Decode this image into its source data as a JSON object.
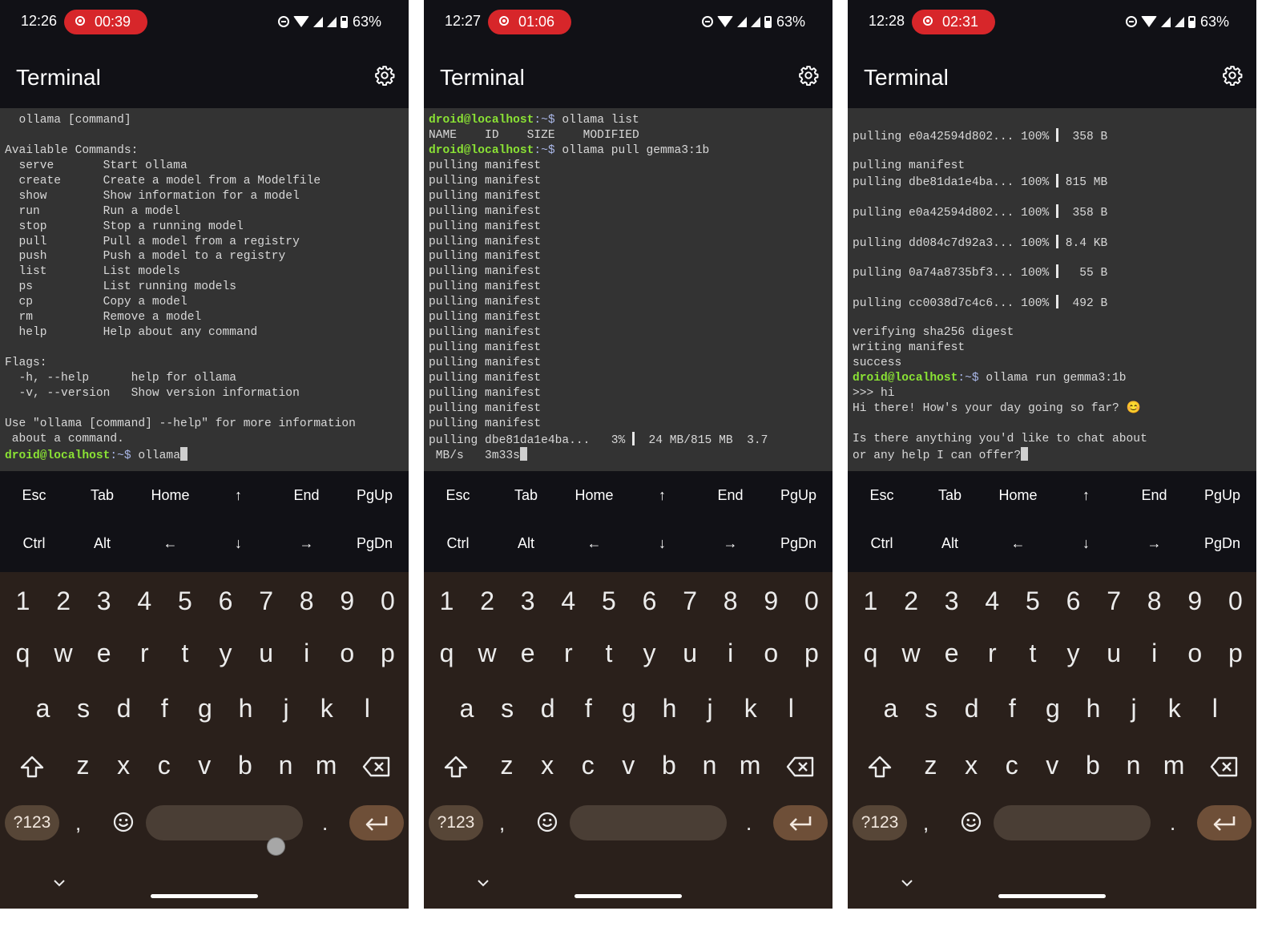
{
  "screens": [
    {
      "clock": "12:26",
      "rec_time": "00:39",
      "battery": "63%",
      "title": "Terminal",
      "show_touch": true,
      "terminal_lines": [
        [
          {
            "t": "  ollama [command]"
          }
        ],
        [
          {
            "t": ""
          }
        ],
        [
          {
            "t": "Available Commands:"
          }
        ],
        [
          {
            "t": "  serve       Start ollama"
          }
        ],
        [
          {
            "t": "  create      Create a model from a Modelfile"
          }
        ],
        [
          {
            "t": "  show        Show information for a model"
          }
        ],
        [
          {
            "t": "  run         Run a model"
          }
        ],
        [
          {
            "t": "  stop        Stop a running model"
          }
        ],
        [
          {
            "t": "  pull        Pull a model from a registry"
          }
        ],
        [
          {
            "t": "  push        Push a model to a registry"
          }
        ],
        [
          {
            "t": "  list        List models"
          }
        ],
        [
          {
            "t": "  ps          List running models"
          }
        ],
        [
          {
            "t": "  cp          Copy a model"
          }
        ],
        [
          {
            "t": "  rm          Remove a model"
          }
        ],
        [
          {
            "t": "  help        Help about any command"
          }
        ],
        [
          {
            "t": ""
          }
        ],
        [
          {
            "t": "Flags:"
          }
        ],
        [
          {
            "t": "  -h, --help      help for ollama"
          }
        ],
        [
          {
            "t": "  -v, --version   Show version information"
          }
        ],
        [
          {
            "t": ""
          }
        ],
        [
          {
            "t": "Use \"ollama [command] --help\" for more information"
          }
        ],
        [
          {
            "t": " about a command."
          }
        ],
        [
          {
            "t": "droid@localhost",
            "c": "user"
          },
          {
            "t": ":~$ ",
            "c": "path"
          },
          {
            "t": "ollama"
          },
          {
            "cursor": true
          }
        ]
      ]
    },
    {
      "clock": "12:27",
      "rec_time": "01:06",
      "battery": "63%",
      "title": "Terminal",
      "show_touch": false,
      "terminal_lines": [
        [
          {
            "t": "droid@localhost",
            "c": "user"
          },
          {
            "t": ":~$ ",
            "c": "path"
          },
          {
            "t": "ollama list"
          }
        ],
        [
          {
            "t": "NAME    ID    SIZE    MODIFIED"
          }
        ],
        [
          {
            "t": "droid@localhost",
            "c": "user"
          },
          {
            "t": ":~$ ",
            "c": "path"
          },
          {
            "t": "ollama pull gemma3:1b"
          }
        ],
        [
          {
            "t": "pulling manifest"
          }
        ],
        [
          {
            "t": "pulling manifest"
          }
        ],
        [
          {
            "t": "pulling manifest"
          }
        ],
        [
          {
            "t": "pulling manifest"
          }
        ],
        [
          {
            "t": "pulling manifest"
          }
        ],
        [
          {
            "t": "pulling manifest"
          }
        ],
        [
          {
            "t": "pulling manifest"
          }
        ],
        [
          {
            "t": "pulling manifest"
          }
        ],
        [
          {
            "t": "pulling manifest"
          }
        ],
        [
          {
            "t": "pulling manifest"
          }
        ],
        [
          {
            "t": "pulling manifest"
          }
        ],
        [
          {
            "t": "pulling manifest"
          }
        ],
        [
          {
            "t": "pulling manifest"
          }
        ],
        [
          {
            "t": "pulling manifest"
          }
        ],
        [
          {
            "t": "pulling manifest"
          }
        ],
        [
          {
            "t": "pulling manifest"
          }
        ],
        [
          {
            "t": "pulling manifest"
          }
        ],
        [
          {
            "t": "pulling manifest"
          }
        ],
        [
          {
            "t": "pulling dbe81da1e4ba...   3% "
          },
          {
            "bar": true
          },
          {
            "t": "  24 MB/815 MB  3.7"
          }
        ],
        [
          {
            "t": " MB/s   3m33s"
          },
          {
            "cursor": true
          }
        ]
      ]
    },
    {
      "clock": "12:28",
      "rec_time": "02:31",
      "battery": "63%",
      "title": "Terminal",
      "show_touch": false,
      "terminal_lines": [
        [
          {
            "t": ""
          }
        ],
        [
          {
            "t": "pulling e0a42594d802... 100% "
          },
          {
            "bar": true
          },
          {
            "t": "  358 B"
          }
        ],
        [
          {
            "t": ""
          }
        ],
        [
          {
            "t": "pulling manifest"
          }
        ],
        [
          {
            "t": "pulling dbe81da1e4ba... 100% "
          },
          {
            "bar": true
          },
          {
            "t": " 815 MB"
          }
        ],
        [
          {
            "t": ""
          }
        ],
        [
          {
            "t": "pulling e0a42594d802... 100% "
          },
          {
            "bar": true
          },
          {
            "t": "  358 B"
          }
        ],
        [
          {
            "t": ""
          }
        ],
        [
          {
            "t": "pulling dd084c7d92a3... 100% "
          },
          {
            "bar": true
          },
          {
            "t": " 8.4 KB"
          }
        ],
        [
          {
            "t": ""
          }
        ],
        [
          {
            "t": "pulling 0a74a8735bf3... 100% "
          },
          {
            "bar": true
          },
          {
            "t": "   55 B"
          }
        ],
        [
          {
            "t": ""
          }
        ],
        [
          {
            "t": "pulling cc0038d7c4c6... 100% "
          },
          {
            "bar": true
          },
          {
            "t": "  492 B"
          }
        ],
        [
          {
            "t": ""
          }
        ],
        [
          {
            "t": "verifying sha256 digest"
          }
        ],
        [
          {
            "t": "writing manifest"
          }
        ],
        [
          {
            "t": "success"
          }
        ],
        [
          {
            "t": "droid@localhost",
            "c": "user"
          },
          {
            "t": ":~$ ",
            "c": "path"
          },
          {
            "t": "ollama run gemma3:1b"
          }
        ],
        [
          {
            "t": ">>> hi"
          }
        ],
        [
          {
            "t": "Hi there! How's your day going so far? "
          },
          {
            "t": "😊",
            "c": "emo"
          }
        ],
        [
          {
            "t": ""
          }
        ],
        [
          {
            "t": "Is there anything you'd like to chat about"
          }
        ],
        [
          {
            "t": "or any help I can offer?"
          },
          {
            "cursor": true
          }
        ]
      ]
    }
  ],
  "extra_keys": {
    "row1": [
      "Esc",
      "Tab",
      "Home",
      "↑",
      "End",
      "PgUp"
    ],
    "row2": [
      "Ctrl",
      "Alt",
      "←",
      "↓",
      "→",
      "PgDn"
    ]
  },
  "keyboard": {
    "digits": [
      "1",
      "2",
      "3",
      "4",
      "5",
      "6",
      "7",
      "8",
      "9",
      "0"
    ],
    "row_q": [
      "q",
      "w",
      "e",
      "r",
      "t",
      "y",
      "u",
      "i",
      "o",
      "p"
    ],
    "row_a": [
      "a",
      "s",
      "d",
      "f",
      "g",
      "h",
      "j",
      "k",
      "l"
    ],
    "row_z": [
      "z",
      "x",
      "c",
      "v",
      "b",
      "n",
      "m"
    ],
    "symbols_label": "?123",
    "comma": ",",
    "period": "."
  },
  "colors": {
    "terminal_bg": "#333333",
    "prompt_user": "#8ae234",
    "prompt_path": "#a9b6e6",
    "record_badge": "#d7262a",
    "keyboard_bg": "#2a201b"
  },
  "icons": [
    "record-icon",
    "dnd-icon",
    "wifi-icon",
    "signal-icon",
    "battery-icon",
    "gear-icon",
    "shift-icon",
    "backspace-icon",
    "emoji-icon",
    "enter-icon",
    "chevron-down-icon"
  ]
}
